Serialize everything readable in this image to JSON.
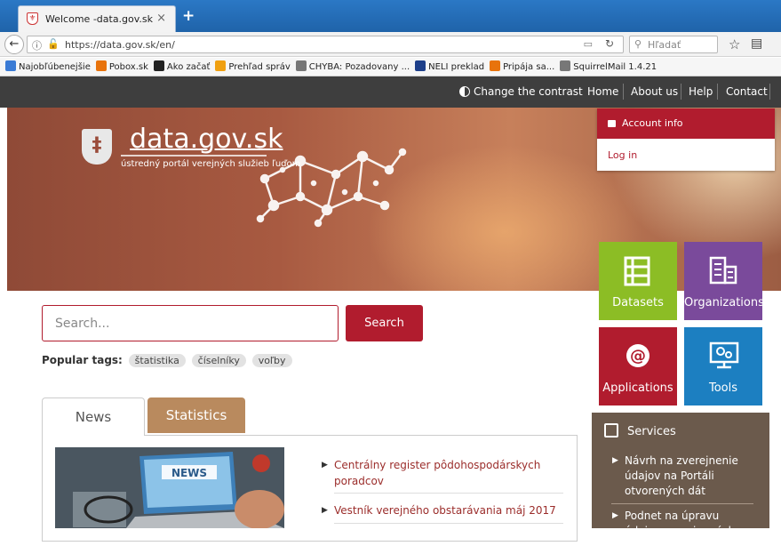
{
  "browser": {
    "tab_title": "Welcome -data.gov.sk",
    "tab_close": "×",
    "new_tab": "+",
    "url": "https://data.gov.sk/en/",
    "search_placeholder": "Hľadať",
    "bookmarks": [
      {
        "label": "Najobľúbenejšie",
        "color": "#3a7bd5",
        "icon": "folder-icon"
      },
      {
        "label": "Pobox.sk",
        "color": "#e8730c",
        "icon": "pobox-icon"
      },
      {
        "label": "Ako začať",
        "color": "#222222",
        "icon": "m-icon"
      },
      {
        "label": "Prehľad správ",
        "color": "#f0a010",
        "icon": "rss-icon"
      },
      {
        "label": "CHYBA: Pozadovany ...",
        "color": "#777777",
        "icon": "globe-icon"
      },
      {
        "label": "NELI preklad",
        "color": "#1d3f8a",
        "icon": "neli-icon"
      },
      {
        "label": "Pripája sa...",
        "color": "#e8730c",
        "icon": "pobox-icon"
      },
      {
        "label": "SquirrelMail 1.4.21",
        "color": "#777777",
        "icon": "globe-icon"
      }
    ]
  },
  "site": {
    "contrast_label": "Change the contrast",
    "nav": [
      "Home",
      "About us",
      "Help",
      "Contact"
    ],
    "logo_title": "data.gov.sk",
    "logo_subtitle": "ústredný portál verejných služieb ľuďom",
    "account": {
      "header": "Account info",
      "login": "Log in"
    },
    "tiles": [
      {
        "label": "Datasets",
        "color": "#8cbd25"
      },
      {
        "label": "Organizations",
        "color": "#7a4a9b"
      },
      {
        "label": "Applications",
        "color": "#b11c2e"
      },
      {
        "label": "Tools",
        "color": "#1c7fc1"
      }
    ],
    "search": {
      "placeholder": "Search...",
      "button": "Search"
    },
    "popular": {
      "label": "Popular tags:",
      "tags": [
        "štatistika",
        "číselníky",
        "voľby"
      ]
    },
    "tabs": {
      "news": "News",
      "statistics": "Statistics"
    },
    "news_image_text": "NEWS",
    "news_items": [
      "Centrálny register pôdohospodárskych poradcov",
      "Vestník verejného obstarávania máj 2017"
    ],
    "services": {
      "title": "Services",
      "items": [
        "Návrh na zverejnenie údajov na Portáli otvorených dát",
        "Podnet na úpravu údajov zverejnených na Portáli"
      ]
    },
    "accent_color": "#b11c2e"
  }
}
